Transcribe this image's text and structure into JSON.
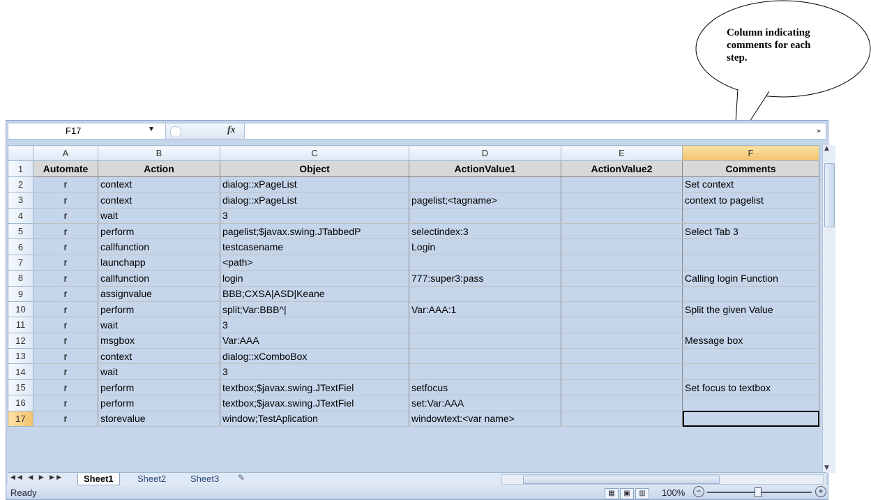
{
  "callout": {
    "text_line1": "Column indicating",
    "text_line2": "comments for each",
    "text_line3": "step."
  },
  "formula_bar": {
    "name_box": "F17",
    "fx_label": "fx",
    "formula": ""
  },
  "columns": [
    "A",
    "B",
    "C",
    "D",
    "E",
    "F"
  ],
  "header_row": {
    "row": "1",
    "cells": [
      "Automate",
      "Action",
      "Object",
      "ActionValue1",
      "ActionValue2",
      "Comments"
    ]
  },
  "rows": [
    {
      "row": "2",
      "cells": [
        "r",
        "context",
        "dialog::xPageList",
        "",
        "",
        "Set context"
      ]
    },
    {
      "row": "3",
      "cells": [
        "r",
        "context",
        "dialog::xPageList",
        "pagelist;<tagname>",
        "",
        "context to pagelist"
      ]
    },
    {
      "row": "4",
      "cells": [
        "r",
        "wait",
        "3",
        "",
        "",
        ""
      ]
    },
    {
      "row": "5",
      "cells": [
        "r",
        "perform",
        "pagelist;$javax.swing.JTabbedP",
        "selectindex:3",
        "",
        "Select Tab 3"
      ]
    },
    {
      "row": "6",
      "cells": [
        "r",
        "callfunction",
        "testcasename",
        "Login",
        "",
        ""
      ]
    },
    {
      "row": "7",
      "cells": [
        "r",
        "launchapp",
        "<path>",
        "",
        "",
        ""
      ]
    },
    {
      "row": "8",
      "cells": [
        "r",
        "callfunction",
        "login",
        "777:super3:pass",
        "",
        "Calling login Function"
      ]
    },
    {
      "row": "9",
      "cells": [
        "r",
        "assignvalue",
        "BBB;CXSA|ASD|Keane",
        "",
        "",
        ""
      ]
    },
    {
      "row": "10",
      "cells": [
        "r",
        "perform",
        "split;Var:BBB^|",
        "Var:AAA:1",
        "",
        "Split the given Value"
      ]
    },
    {
      "row": "11",
      "cells": [
        "r",
        "wait",
        "3",
        "",
        "",
        ""
      ]
    },
    {
      "row": "12",
      "cells": [
        "r",
        "msgbox",
        "Var:AAA",
        "",
        "",
        "Message box"
      ]
    },
    {
      "row": "13",
      "cells": [
        "r",
        "context",
        "dialog::xComboBox",
        "",
        "",
        ""
      ]
    },
    {
      "row": "14",
      "cells": [
        "r",
        "wait",
        "3",
        "",
        "",
        ""
      ]
    },
    {
      "row": "15",
      "cells": [
        "r",
        "perform",
        "textbox;$javax.swing.JTextFiel",
        "setfocus",
        "",
        "Set focus to textbox"
      ]
    },
    {
      "row": "16",
      "cells": [
        "r",
        "perform",
        "textbox;$javax.swing.JTextFiel",
        "set:Var:AAA",
        "",
        ""
      ]
    },
    {
      "row": "17",
      "cells": [
        "r",
        "storevalue",
        "window;TestAplication",
        "windowtext:<var name>",
        "",
        ""
      ]
    }
  ],
  "sheet_tabs": [
    "Sheet1",
    "Sheet2",
    "Sheet3"
  ],
  "status": {
    "ready": "Ready",
    "zoom": "100%"
  }
}
